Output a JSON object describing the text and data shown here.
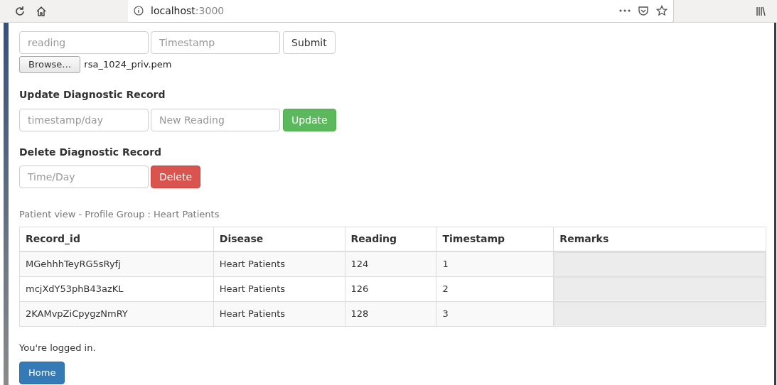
{
  "browser": {
    "address_host": "localhost",
    "address_port": ":3000"
  },
  "add_form": {
    "fields": [
      {
        "placeholder": "reading"
      },
      {
        "placeholder": "Timestamp"
      }
    ],
    "submit": "Submit",
    "browse": "Browse…",
    "file_name": "rsa_1024_priv.pem"
  },
  "update_form": {
    "heading": "Update Diagnostic Record",
    "fields": [
      {
        "placeholder": "timestamp/day"
      },
      {
        "placeholder": "New Reading"
      }
    ],
    "button": "Update"
  },
  "delete_form": {
    "heading": "Delete Diagnostic Record",
    "fields": [
      {
        "placeholder": "Time/Day"
      }
    ],
    "button": "Delete"
  },
  "table": {
    "caption": "Patient view - Profile Group : Heart Patients",
    "columns": [
      "Record_id",
      "Disease",
      "Reading",
      "Timestamp",
      "Remarks"
    ],
    "rows": [
      {
        "cells": [
          "MGehhhTeyRG5sRyfj",
          "Heart Patients",
          "124",
          "1"
        ],
        "remarks_disabled": true
      },
      {
        "cells": [
          "mcjXdY53phB43azKL",
          "Heart Patients",
          "126",
          "2"
        ],
        "remarks_disabled": true
      },
      {
        "cells": [
          "2KAMvpZiCpygzNmRY",
          "Heart Patients",
          "128",
          "3"
        ],
        "remarks_disabled": true
      }
    ]
  },
  "status": "You're logged in.",
  "home_button": "Home"
}
